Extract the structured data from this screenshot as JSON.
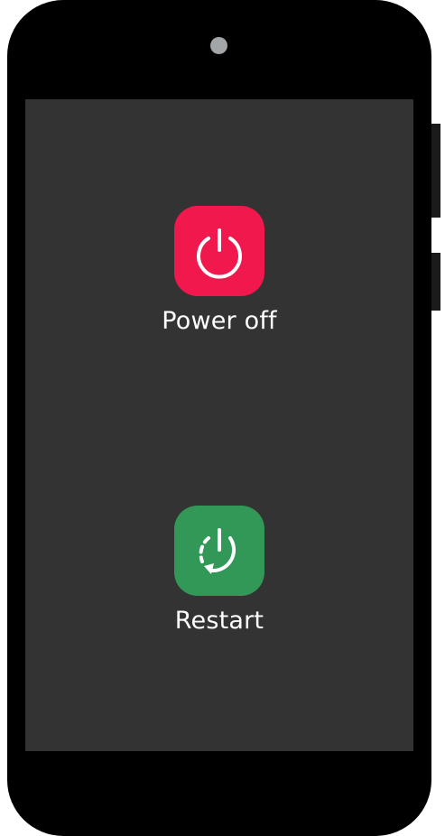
{
  "screen": {
    "background": "#333333"
  },
  "actions": [
    {
      "label": "Power off",
      "icon": "power-icon",
      "color": "#f0184c"
    },
    {
      "label": "Restart",
      "icon": "restart-icon",
      "color": "#329858"
    }
  ]
}
